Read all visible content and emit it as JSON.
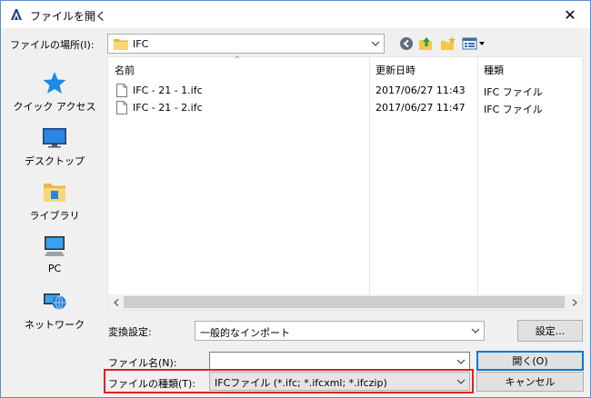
{
  "window": {
    "title": "ファイルを開く",
    "close_glyph": "✕"
  },
  "location": {
    "label": "ファイルの場所(I):",
    "value": "IFC"
  },
  "places": [
    {
      "label": "クイック アクセス",
      "icon": "star-icon"
    },
    {
      "label": "デスクトップ",
      "icon": "desktop-icon"
    },
    {
      "label": "ライブラリ",
      "icon": "library-icon"
    },
    {
      "label": "PC",
      "icon": "pc-icon"
    },
    {
      "label": "ネットワーク",
      "icon": "network-icon"
    }
  ],
  "filelist": {
    "columns": {
      "name": "名前",
      "date": "更新日時",
      "type": "種類"
    },
    "sort_caret": "^",
    "rows": [
      {
        "name": "IFC - 21 - 1.ifc",
        "date": "2017/06/27 11:43",
        "type": "IFC ファイル"
      },
      {
        "name": "IFC - 21 - 2.ifc",
        "date": "2017/06/27 11:47",
        "type": "IFC ファイル"
      }
    ]
  },
  "conversion": {
    "label": "変換設定:",
    "value": "一般的なインポート",
    "settings_button": "設定..."
  },
  "filename": {
    "label": "ファイル名(N):",
    "value": "",
    "open_button": "開く(O)"
  },
  "filetype": {
    "label": "ファイルの種類(T):",
    "value": "IFCファイル (*.ifc; *.ifcxml; *.ifczip)",
    "cancel_button": "キャンセル"
  },
  "colors": {
    "highlight": "#e02020",
    "accent": "#0078d7"
  }
}
